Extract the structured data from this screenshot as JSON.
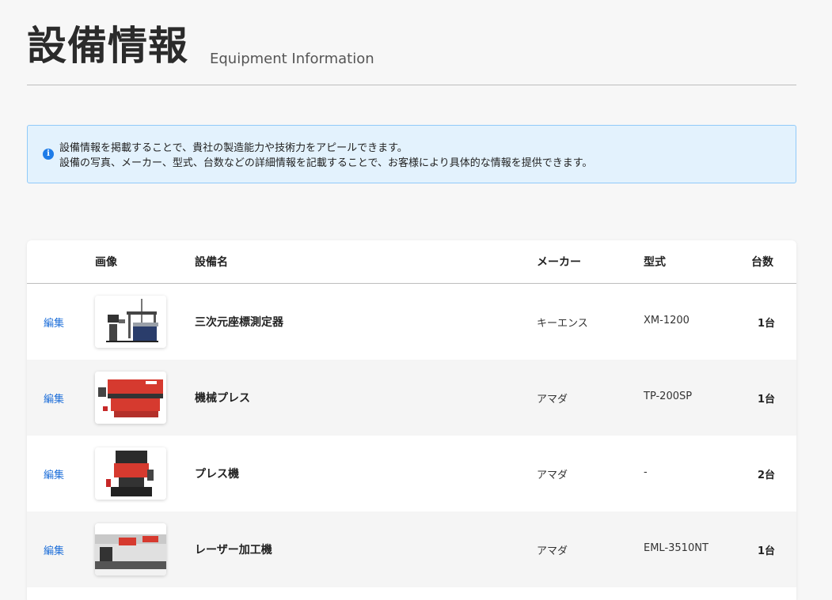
{
  "header": {
    "title": "設備情報",
    "subtitle": "Equipment Information"
  },
  "notice": {
    "icon": "info-icon",
    "line1": "設備情報を掲載することで、貴社の製造能力や技術力をアピールできます。",
    "line2": "設備の写真、メーカー、型式、台数などの詳細情報を記載することで、お客様により具体的な情報を提供できます。",
    "accent_color": "#1e7ce8"
  },
  "table": {
    "columns": {
      "image": "画像",
      "name": "設備名",
      "maker": "メーカー",
      "model": "型式",
      "count": "台数"
    },
    "rows": [
      {
        "edit": "編集",
        "name": "三次元座標測定器",
        "maker": "キーエンス",
        "model": "XM-1200",
        "count": "1台",
        "image": "cmm-machine-photo"
      },
      {
        "edit": "編集",
        "name": "機械プレス",
        "maker": "アマダ",
        "model": "TP-200SP",
        "count": "1台",
        "image": "press-brake-photo"
      },
      {
        "edit": "編集",
        "name": "プレス機",
        "maker": "アマダ",
        "model": "-",
        "count": "2台",
        "image": "press-machine-photo"
      },
      {
        "edit": "編集",
        "name": "レーザー加工機",
        "maker": "アマダ",
        "model": "EML-3510NT",
        "count": "1台",
        "image": "laser-machine-photo"
      }
    ]
  },
  "colors": {
    "link": "#1e6fd9",
    "notice_bg": "#e3f2fd",
    "notice_border": "#90caf9",
    "machine_red": "#d63a2f"
  }
}
